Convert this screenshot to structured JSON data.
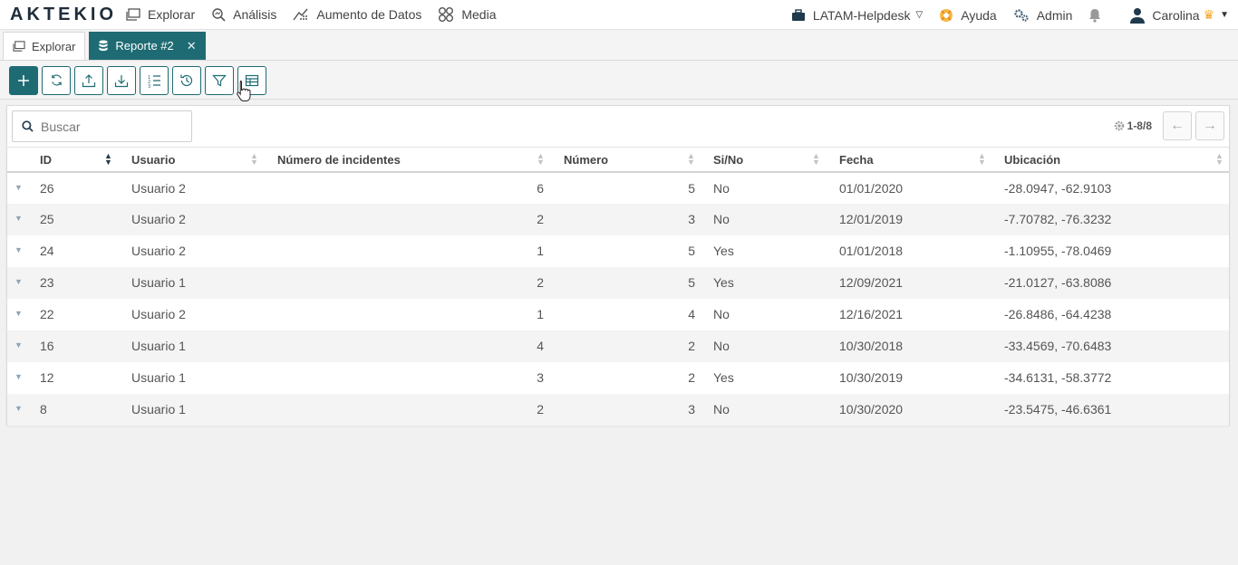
{
  "app": {
    "logo_text": "AKTEKIO",
    "nav": [
      {
        "label": "Explorar",
        "icon": "window-icon"
      },
      {
        "label": "Análisis",
        "icon": "magnifier-chart-icon"
      },
      {
        "label": "Aumento de Datos",
        "icon": "data-augment-icon"
      },
      {
        "label": "Media",
        "icon": "media-icon"
      }
    ],
    "workspace": "LATAM-Helpdesk",
    "help_label": "Ayuda",
    "admin_label": "Admin",
    "user_name": "Carolina"
  },
  "tabs": [
    {
      "label": "Explorar",
      "icon": "window-icon",
      "active": false
    },
    {
      "label": "Reporte #2",
      "icon": "database-icon",
      "active": true
    }
  ],
  "toolbar": [
    "add-icon",
    "refresh-icon",
    "upload-icon",
    "download-icon",
    "sort-list-icon",
    "history-icon",
    "filter-icon",
    "table-columns-icon"
  ],
  "search": {
    "placeholder": "Buscar"
  },
  "pager": {
    "range": "1-8/8"
  },
  "table": {
    "columns": [
      "ID",
      "Usuario",
      "Número de incidentes",
      "Número",
      "Si/No",
      "Fecha",
      "Ubicación"
    ],
    "rows": [
      {
        "id": "26",
        "usuario": "Usuario 2",
        "incidentes": "6",
        "numero": "5",
        "sino": "No",
        "fecha": "01/01/2020",
        "ubicacion": "-28.0947, -62.9103"
      },
      {
        "id": "25",
        "usuario": "Usuario 2",
        "incidentes": "2",
        "numero": "3",
        "sino": "No",
        "fecha": "12/01/2019",
        "ubicacion": "-7.70782, -76.3232"
      },
      {
        "id": "24",
        "usuario": "Usuario 2",
        "incidentes": "1",
        "numero": "5",
        "sino": "Yes",
        "fecha": "01/01/2018",
        "ubicacion": "-1.10955, -78.0469"
      },
      {
        "id": "23",
        "usuario": "Usuario 1",
        "incidentes": "2",
        "numero": "5",
        "sino": "Yes",
        "fecha": "12/09/2021",
        "ubicacion": "-21.0127, -63.8086"
      },
      {
        "id": "22",
        "usuario": "Usuario 2",
        "incidentes": "1",
        "numero": "4",
        "sino": "No",
        "fecha": "12/16/2021",
        "ubicacion": "-26.8486, -64.4238"
      },
      {
        "id": "16",
        "usuario": "Usuario 1",
        "incidentes": "4",
        "numero": "2",
        "sino": "No",
        "fecha": "10/30/2018",
        "ubicacion": "-33.4569, -70.6483"
      },
      {
        "id": "12",
        "usuario": "Usuario 1",
        "incidentes": "3",
        "numero": "2",
        "sino": "Yes",
        "fecha": "10/30/2019",
        "ubicacion": "-34.6131, -58.3772"
      },
      {
        "id": "8",
        "usuario": "Usuario 1",
        "incidentes": "2",
        "numero": "3",
        "sino": "No",
        "fecha": "10/30/2020",
        "ubicacion": "-23.5475, -46.6361"
      }
    ]
  },
  "colors": {
    "accent": "#1f6b73",
    "crown": "#f5a623"
  }
}
